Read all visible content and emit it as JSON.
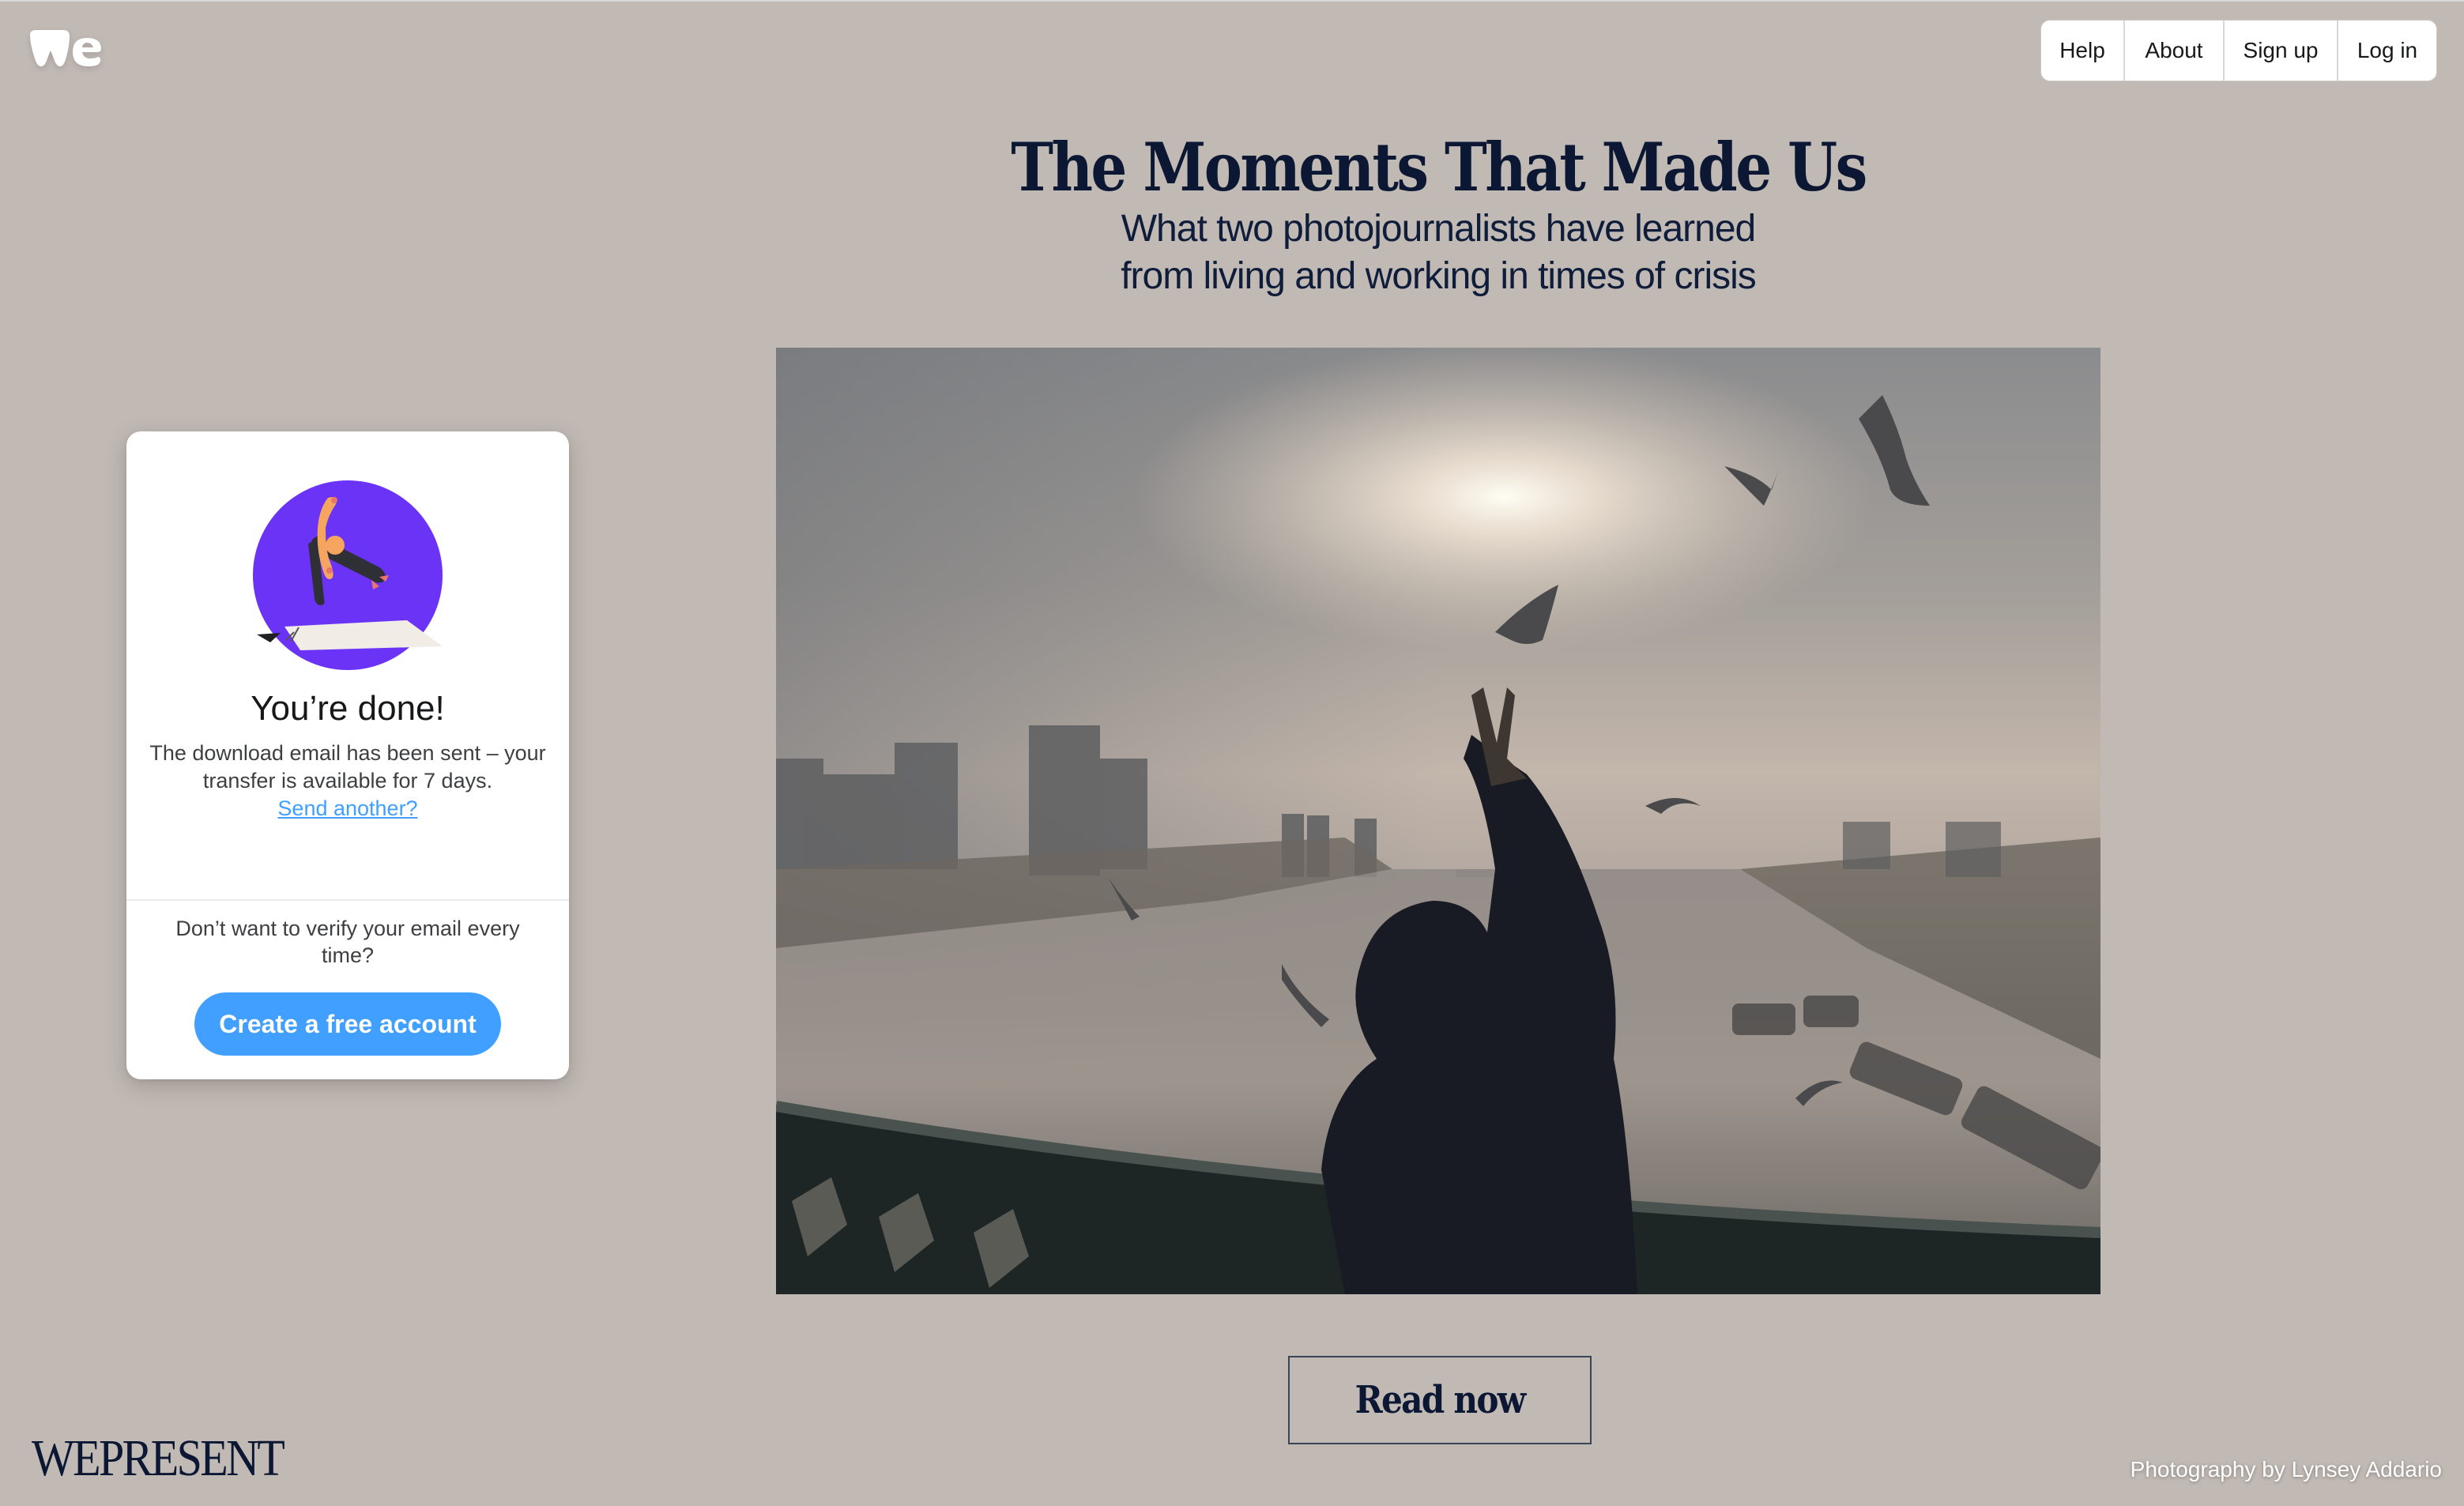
{
  "brand": {
    "logo_icon": "wetransfer-we-logo",
    "footer_brand": "WEPRESENT"
  },
  "topnav": {
    "items": [
      {
        "label": "Help"
      },
      {
        "label": "About"
      },
      {
        "label": "Sign up"
      },
      {
        "label": "Log in"
      }
    ]
  },
  "feature": {
    "headline": "The Moments That Made Us",
    "subhead_line1": "What two photojournalists have learned",
    "subhead_line2": "from living and working in times of crisis",
    "image_alt": "Man on a bridge raising a peace sign toward seagulls over a misty river",
    "cta_label": "Read now",
    "credit": "Photography by Lynsey Addario"
  },
  "transfer_card": {
    "illustration_icon": "person-flying-on-paper-illustration",
    "title": "You’re done!",
    "body": "The download email has been sent – your transfer is available for 7 days.",
    "link_label": "Send another?",
    "footer_text": "Don’t want to verify your email every time?",
    "button_label": "Create a free account"
  },
  "colors": {
    "background": "#c1b9b4",
    "accent_blue": "#409fff",
    "illustration_purple": "#6a33f5",
    "navy_text": "#0b1733"
  }
}
